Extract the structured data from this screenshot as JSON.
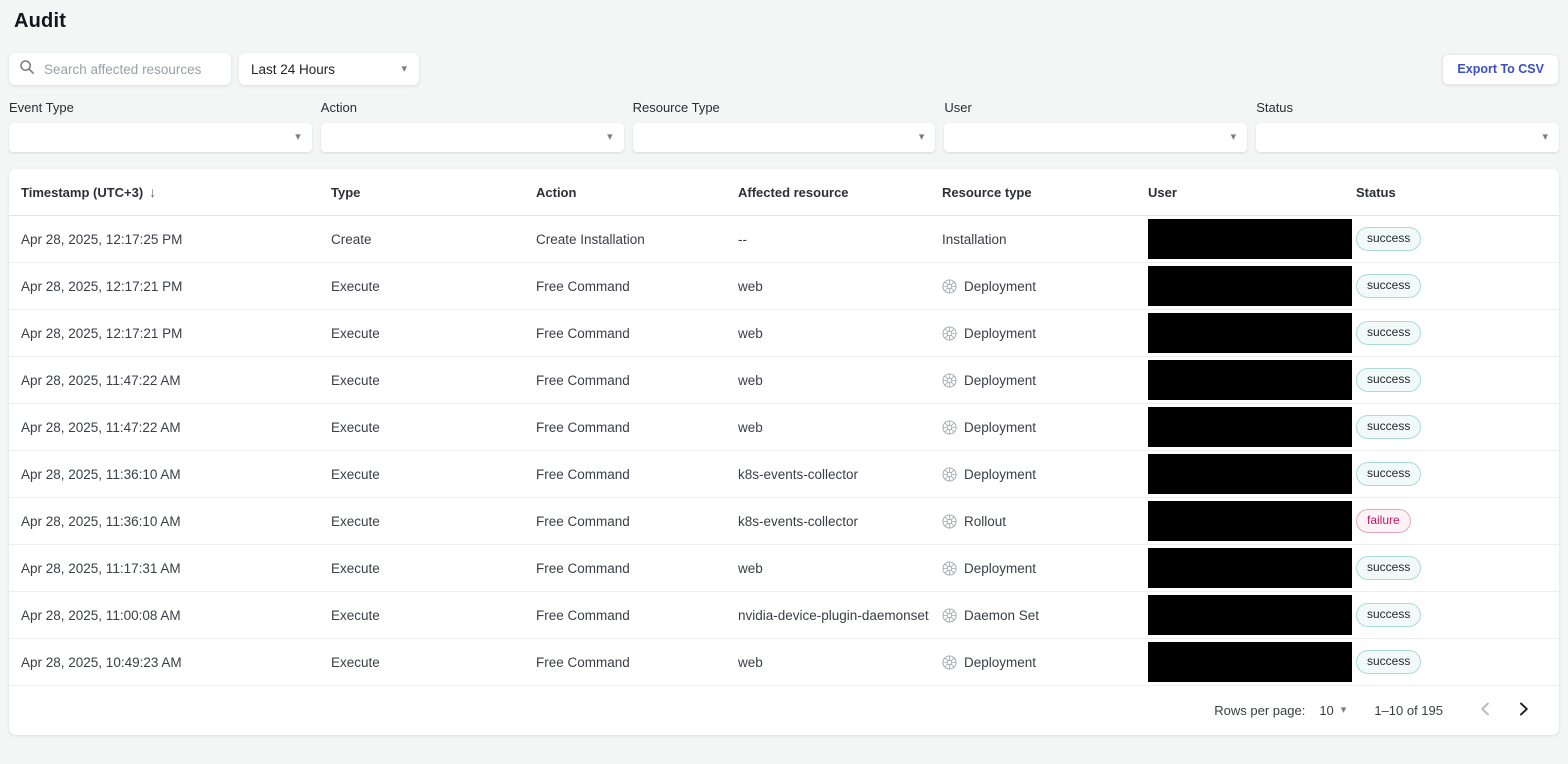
{
  "page": {
    "title": "Audit"
  },
  "toolbar": {
    "search_placeholder": "Search affected resources",
    "time_range_value": "Last 24 Hours",
    "export_button_label": "Export To CSV"
  },
  "filters": [
    {
      "label": "Event Type",
      "value": ""
    },
    {
      "label": "Action",
      "value": ""
    },
    {
      "label": "Resource Type",
      "value": ""
    },
    {
      "label": "User",
      "value": ""
    },
    {
      "label": "Status",
      "value": ""
    }
  ],
  "table": {
    "columns": [
      "Timestamp (UTC+3)",
      "Type",
      "Action",
      "Affected resource",
      "Resource type",
      "User",
      "Status"
    ],
    "sort": {
      "column": "Timestamp (UTC+3)",
      "direction": "desc"
    },
    "rows": [
      {
        "timestamp": "Apr 28, 2025, 12:17:25 PM",
        "type": "Create",
        "action": "Create Installation",
        "affected_resource": "--",
        "resource_type": "Installation",
        "resource_icon": false,
        "user_redacted": true,
        "status": "success"
      },
      {
        "timestamp": "Apr 28, 2025, 12:17:21 PM",
        "type": "Execute",
        "action": "Free Command",
        "affected_resource": "web",
        "resource_type": "Deployment",
        "resource_icon": true,
        "user_redacted": true,
        "status": "success"
      },
      {
        "timestamp": "Apr 28, 2025, 12:17:21 PM",
        "type": "Execute",
        "action": "Free Command",
        "affected_resource": "web",
        "resource_type": "Deployment",
        "resource_icon": true,
        "user_redacted": true,
        "status": "success"
      },
      {
        "timestamp": "Apr 28, 2025, 11:47:22 AM",
        "type": "Execute",
        "action": "Free Command",
        "affected_resource": "web",
        "resource_type": "Deployment",
        "resource_icon": true,
        "user_redacted": true,
        "status": "success"
      },
      {
        "timestamp": "Apr 28, 2025, 11:47:22 AM",
        "type": "Execute",
        "action": "Free Command",
        "affected_resource": "web",
        "resource_type": "Deployment",
        "resource_icon": true,
        "user_redacted": true,
        "status": "success"
      },
      {
        "timestamp": "Apr 28, 2025, 11:36:10 AM",
        "type": "Execute",
        "action": "Free Command",
        "affected_resource": "k8s-events-collector",
        "resource_type": "Deployment",
        "resource_icon": true,
        "user_redacted": true,
        "status": "success"
      },
      {
        "timestamp": "Apr 28, 2025, 11:36:10 AM",
        "type": "Execute",
        "action": "Free Command",
        "affected_resource": "k8s-events-collector",
        "resource_type": "Rollout",
        "resource_icon": true,
        "user_redacted": true,
        "status": "failure"
      },
      {
        "timestamp": "Apr 28, 2025, 11:17:31 AM",
        "type": "Execute",
        "action": "Free Command",
        "affected_resource": "web",
        "resource_type": "Deployment",
        "resource_icon": true,
        "user_redacted": true,
        "status": "success"
      },
      {
        "timestamp": "Apr 28, 2025, 11:00:08 AM",
        "type": "Execute",
        "action": "Free Command",
        "affected_resource": "nvidia-device-plugin-daemonset",
        "resource_type": "Daemon Set",
        "resource_icon": true,
        "user_redacted": true,
        "status": "success"
      },
      {
        "timestamp": "Apr 28, 2025, 10:49:23 AM",
        "type": "Execute",
        "action": "Free Command",
        "affected_resource": "web",
        "resource_type": "Deployment",
        "resource_icon": true,
        "user_redacted": true,
        "status": "success"
      }
    ],
    "pagination": {
      "rows_per_page_label": "Rows per page:",
      "rows_per_page_value": "10",
      "range_text": "1–10 of 195"
    }
  },
  "icons": {
    "search": "magnifier",
    "filter_dropdown": "chevron-down",
    "sort": "arrow-down",
    "resource": "kubernetes-wheel",
    "prev_page": "chevron-left",
    "next_page": "chevron-right"
  },
  "colors": {
    "page_bg": "#f2f6f4",
    "accent_blue": "#3b4fc0",
    "success_border": "#abdcd3",
    "success_bg": "#f1faf8",
    "failure_border": "#e6a8b8",
    "failure_bg": "#fdf3f6",
    "failure_text": "#c2185b",
    "redaction": "#000000"
  }
}
